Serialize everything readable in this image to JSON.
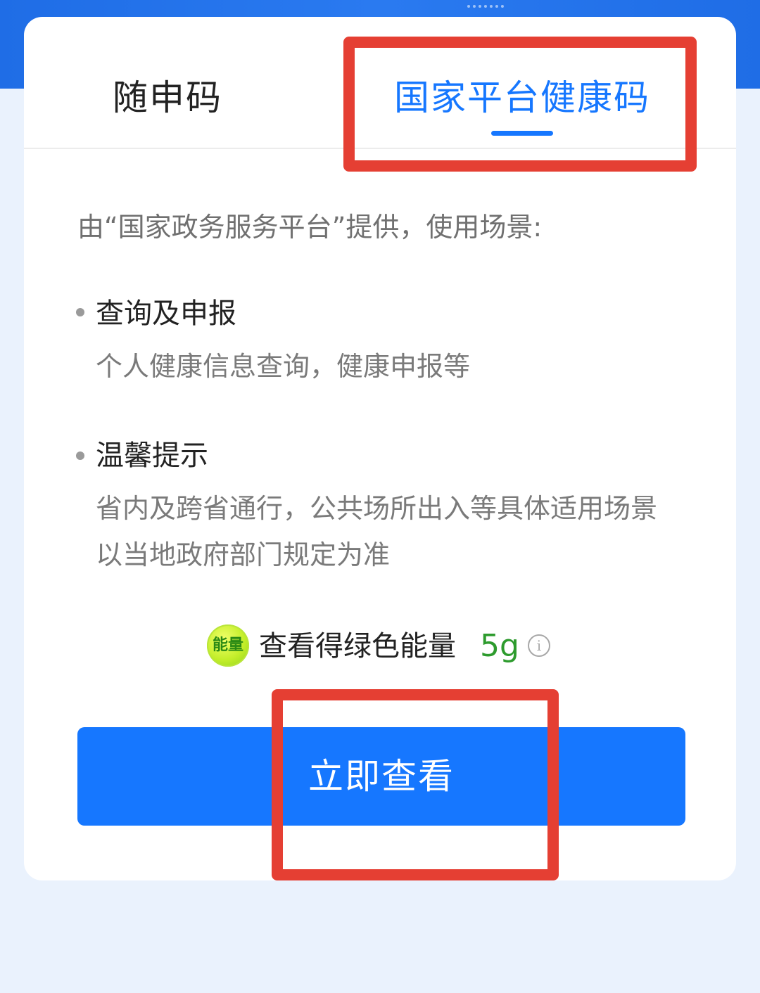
{
  "tabs": {
    "suishen_label": "随申码",
    "national_label": "国家平台健康码",
    "active_tab": "国家平台健康码"
  },
  "intro_text": "由“国家政务服务平台”提供，使用场景:",
  "sections": [
    {
      "title": "查询及申报",
      "description": "个人健康信息查询，健康申报等"
    },
    {
      "title": "温馨提示",
      "description": "省内及跨省通行，公共场所出入等具体适用场景以当地政府部门规定为准"
    }
  ],
  "energy": {
    "badge_label": "能量",
    "text": "查看得绿色能量",
    "amount": "5g",
    "info_icon": "i"
  },
  "button": {
    "label": "立即查看"
  },
  "colors": {
    "accent": "#1677ff",
    "highlight_box": "#e53f33",
    "energy_green": "#2d9b2d",
    "page_background": "#eaf2fd"
  },
  "icons": {
    "energy_badge": "energy-badge-icon",
    "info": "info-icon",
    "bullet": "bullet-dot-icon"
  }
}
